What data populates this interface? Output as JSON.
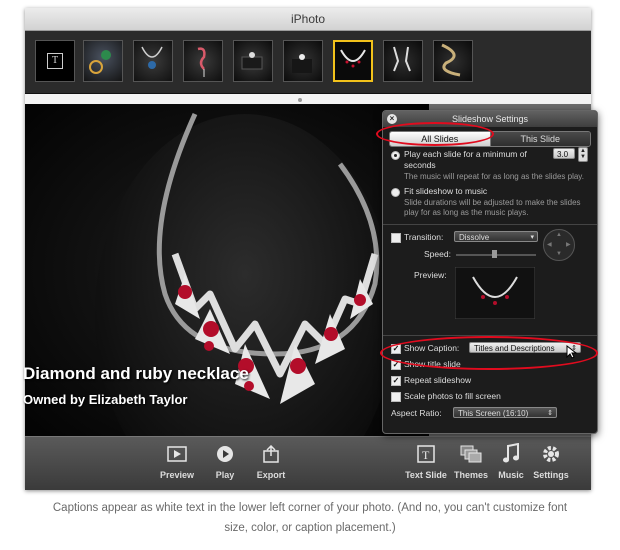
{
  "window": {
    "title": "iPhoto"
  },
  "filmstrip": {
    "text_slide_glyph": "T",
    "thumbnails": [
      {
        "name": "text-slide-thumb",
        "selected": false
      },
      {
        "name": "ring-jewelry-thumb",
        "selected": false
      },
      {
        "name": "pendant-necklace-thumb",
        "selected": false
      },
      {
        "name": "flamingo-brooch-thumb",
        "selected": false
      },
      {
        "name": "ring-box-thumb",
        "selected": false
      },
      {
        "name": "ring-cushion-thumb",
        "selected": false
      },
      {
        "name": "diamond-necklace-thumb",
        "selected": true
      },
      {
        "name": "earrings-thumb",
        "selected": false
      },
      {
        "name": "serpent-necklace-thumb",
        "selected": false
      }
    ]
  },
  "caption": {
    "title": "Diamond and ruby necklace",
    "subtitle": "Owned by Elizabeth Taylor"
  },
  "settings": {
    "title": "Slideshow Settings",
    "tab_all": "All Slides",
    "tab_this": "This Slide",
    "play_each_label": "Play each slide for a minimum of",
    "play_each_label2": "seconds",
    "seconds_value": "3.0",
    "play_note": "The music will repeat for as long as the slides play.",
    "fit_label": "Fit slideshow to music",
    "fit_note": "Slide durations will be adjusted to make the slides play for as long as the music plays.",
    "transition_label": "Transition:",
    "transition_value": "Dissolve",
    "speed_label": "Speed:",
    "preview_label": "Preview:",
    "show_caption_label": "Show Caption:",
    "caption_value": "Titles and Descriptions",
    "show_title_label": "Show title slide",
    "repeat_label": "Repeat slideshow",
    "scale_label": "Scale photos to fill screen",
    "aspect_label": "Aspect Ratio:",
    "aspect_value": "This Screen (16:10)",
    "check_mark": "✓"
  },
  "toolbar": {
    "preview": "Preview",
    "play": "Play",
    "export": "Export",
    "text_slide": "Text Slide",
    "themes": "Themes",
    "music": "Music",
    "settings": "Settings"
  },
  "footer": {
    "line1": "Captions appear as white text in the lower left corner of your photo. (And no, you can't customize font",
    "line2": "size, color, or caption placement.)"
  },
  "colors": {
    "highlight_oval": "#e10b1e",
    "selection_border": "#f2c21b"
  }
}
